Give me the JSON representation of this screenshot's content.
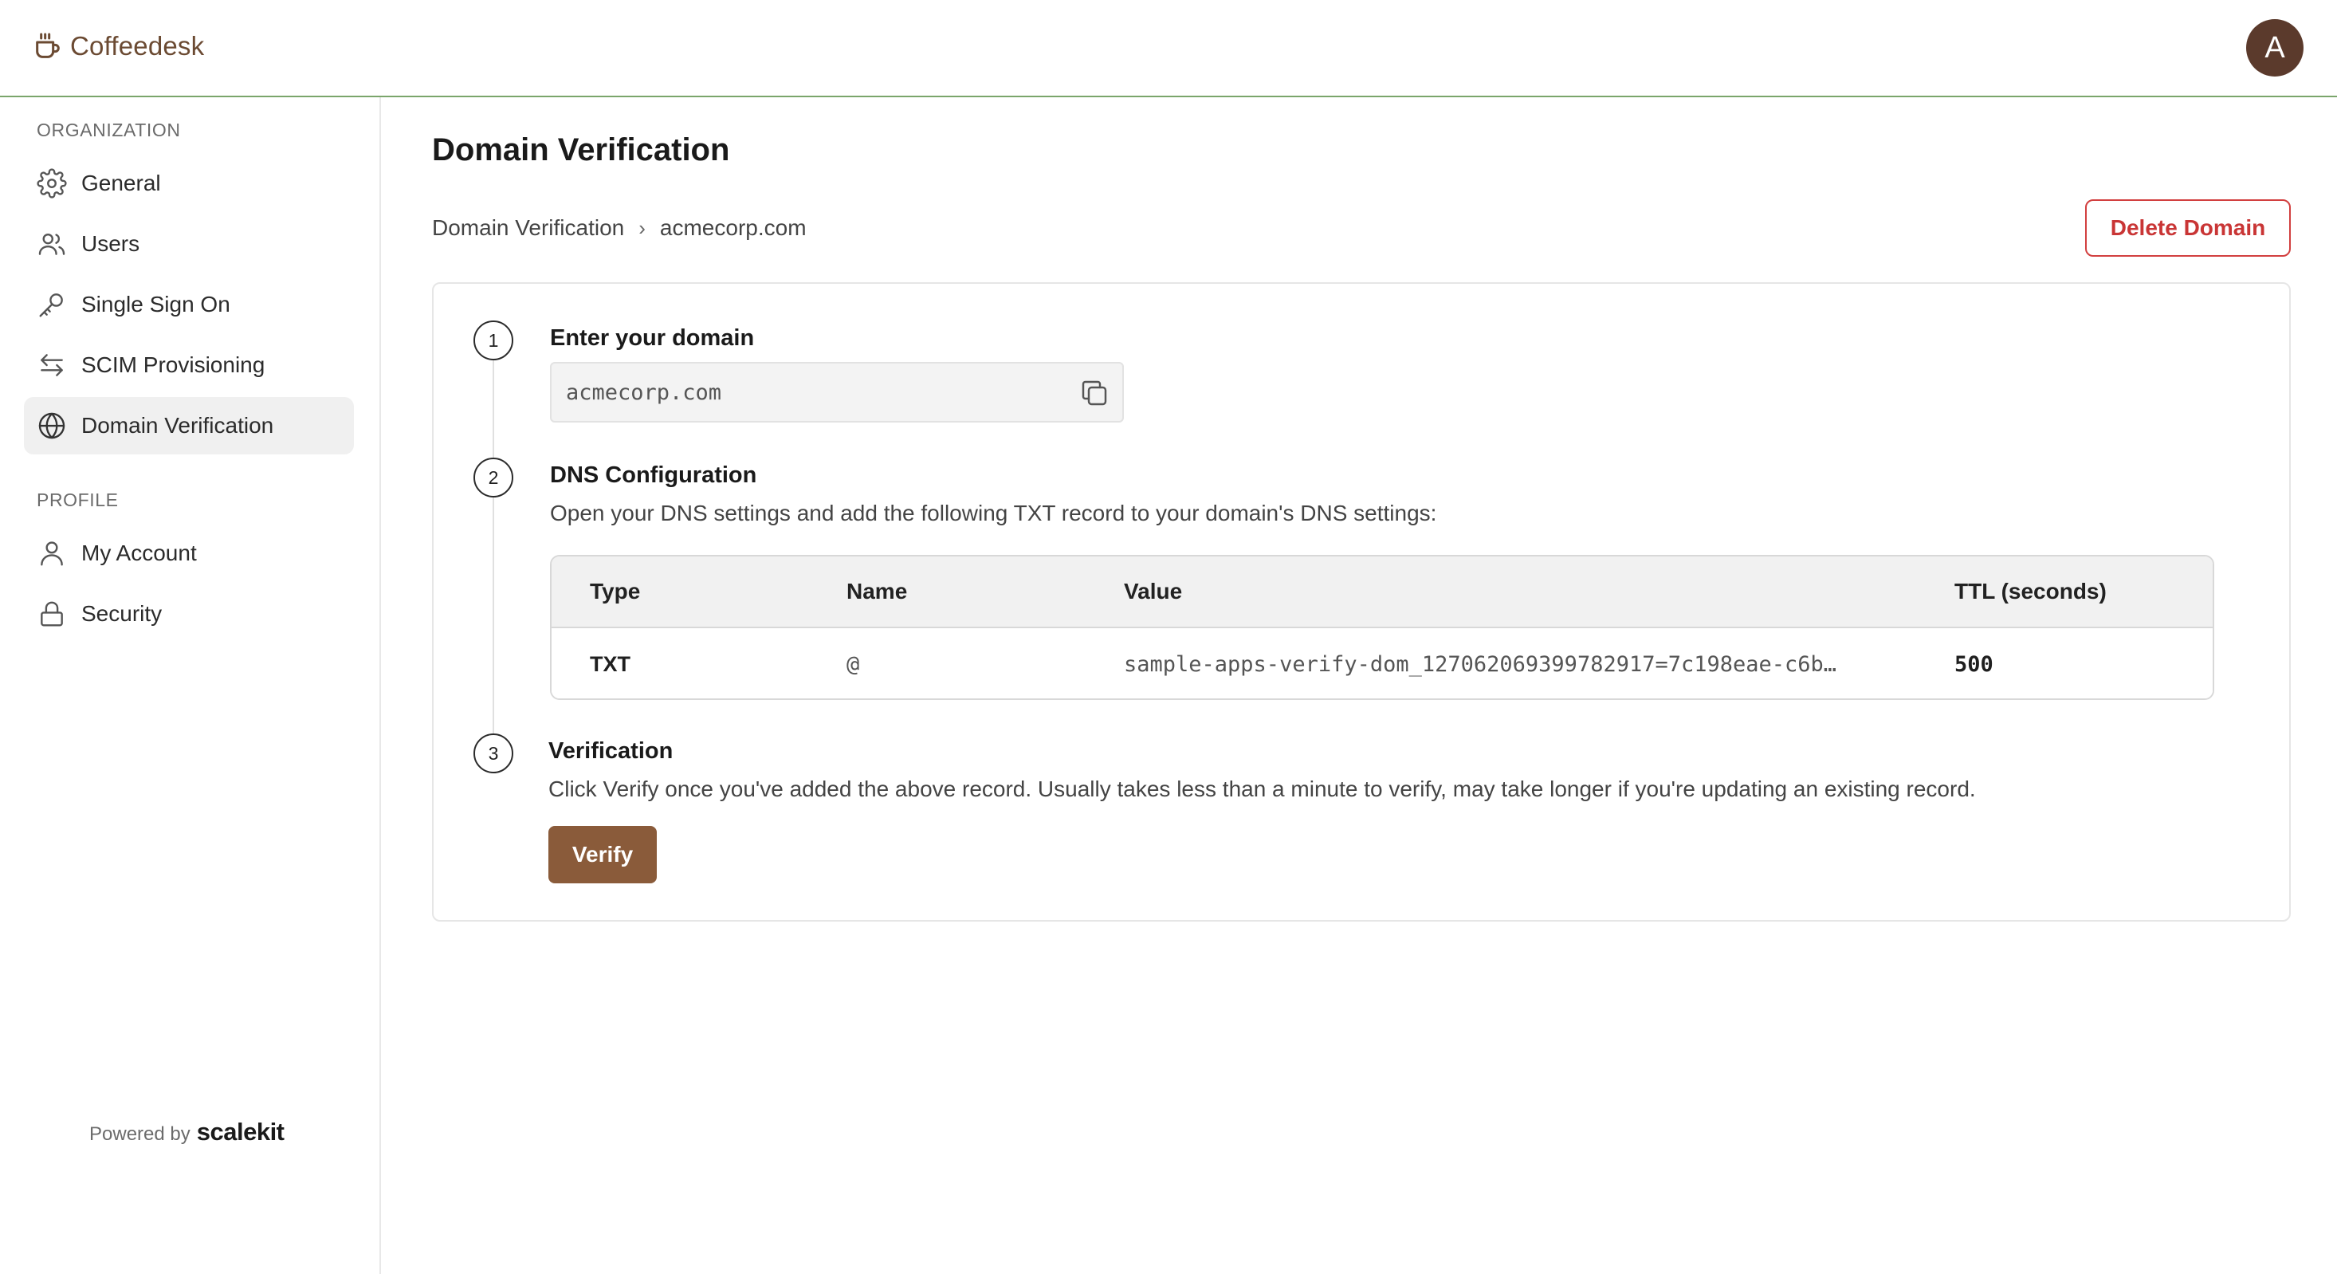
{
  "app": {
    "name": "Coffeedesk",
    "avatar_initial": "A",
    "brand_color": "#6b4a32",
    "accent_border_color": "#7aa56b"
  },
  "sidebar": {
    "organization_label": "ORGANIZATION",
    "profile_label": "PROFILE",
    "items": [
      {
        "label": "General",
        "icon": "gear-icon"
      },
      {
        "label": "Users",
        "icon": "users-icon"
      },
      {
        "label": "Single Sign On",
        "icon": "key-icon"
      },
      {
        "label": "SCIM Provisioning",
        "icon": "arrows-swap-icon"
      },
      {
        "label": "Domain Verification",
        "icon": "globe-icon",
        "active": true
      }
    ],
    "profile_items": [
      {
        "label": "My Account",
        "icon": "user-icon"
      },
      {
        "label": "Security",
        "icon": "lock-icon"
      }
    ],
    "powered_by": "Powered by",
    "powered_brand": "scalekit"
  },
  "main": {
    "title": "Domain Verification",
    "breadcrumb": [
      "Domain Verification",
      "acmecorp.com"
    ],
    "breadcrumb_sep": "›",
    "delete_label": "Delete Domain",
    "delete_color": "#d23f3f",
    "steps": [
      {
        "num": "1",
        "title": "Enter your domain"
      },
      {
        "num": "2",
        "title": "DNS Configuration",
        "desc": "Open your DNS settings and add the following TXT record to your domain's DNS settings:"
      },
      {
        "num": "3",
        "title": "Verification",
        "desc": "Click Verify once you've added the above record. Usually takes less than a minute to verify, may take longer if you're updating an existing record."
      }
    ],
    "domain_value": "acmecorp.com",
    "dns_table": {
      "headers": [
        "Type",
        "Name",
        "Value",
        "TTL (seconds)"
      ],
      "row": [
        "TXT",
        "@",
        "sample-apps-verify-dom_127062069399782917=7c198eae-c6b…",
        "500"
      ]
    },
    "verify_label": "Verify",
    "verify_color": "#8a5b3a"
  }
}
